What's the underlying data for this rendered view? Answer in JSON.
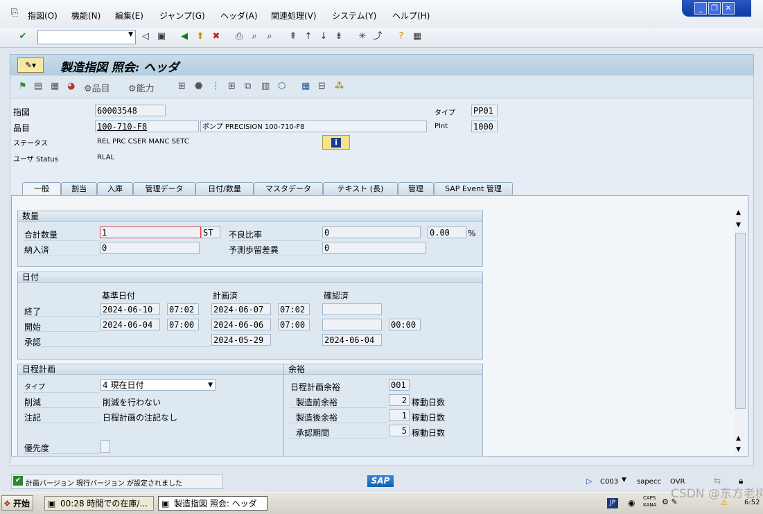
{
  "menu": [
    "指図(O)",
    "機能(N)",
    "編集(E)",
    "ジャンプ(G)",
    "ヘッダ(A)",
    "関連処理(V)",
    "システム(Y)",
    "ヘルプ(H)"
  ],
  "window_controls": {
    "minimize": "_",
    "restore": "❐",
    "close": "✕"
  },
  "title": "製造指図 照会: ヘッダ",
  "app_toolbar": {
    "components": "品目",
    "capacity": "能力"
  },
  "header": {
    "order_label": "指図",
    "order_value": "60003548",
    "material_label": "品目",
    "material_value": "100-710-F8",
    "material_desc": "ポンプ PRECISION 100-710-F8",
    "status_label": "ステータス",
    "status_value": "REL  PRC  CSER MANC SETC",
    "user_status_label": "ユーザ Status",
    "user_status_value": "RLAL",
    "type_label": "タイプ",
    "type_value": "PP01",
    "plant_label": "Plnt",
    "plant_value": "1000",
    "info_icon": "i"
  },
  "tabs": [
    "一般",
    "割当",
    "入庫",
    "管理データ",
    "日付/数量",
    "マスタデータ",
    "テキスト (長)",
    "管理",
    "SAP Event 管理"
  ],
  "quantity": {
    "title": "数量",
    "total_label": "合計数量",
    "total_value": "1",
    "unit": "ST",
    "scrap_label": "不良比率",
    "scrap_value": "0",
    "scrap_pct": "0.00",
    "pct_sign": "%",
    "delivered_label": "納入済",
    "delivered_value": "0",
    "expected_label": "予測歩留差異",
    "expected_value": "0"
  },
  "dates": {
    "title": "日付",
    "col_basic": "基準日付",
    "col_scheduled": "計画済",
    "col_confirmed": "確認済",
    "finish_label": "終了",
    "finish_basic_date": "2024-06-10",
    "finish_basic_time": "07:02",
    "finish_sched_date": "2024-06-07",
    "finish_sched_time": "07:02",
    "start_label": "開始",
    "start_basic_date": "2024-06-04",
    "start_basic_time": "07:00",
    "start_sched_date": "2024-06-06",
    "start_sched_time": "07:00",
    "start_conf_time": "00:00",
    "release_label": "承認",
    "release_sched_date": "2024-05-29",
    "release_conf_date": "2024-06-04"
  },
  "scheduling": {
    "title": "日程計画",
    "type_label": "タイプ",
    "type_value": "4 現在日付",
    "reduction_label": "削減",
    "reduction_value": "削減を行わない",
    "note_label": "注記",
    "note_value": "日程計画の注記なし",
    "priority_label": "優先度"
  },
  "float": {
    "title": "余裕",
    "sm_label": "日程計画余裕",
    "sm_value": "001",
    "before_label": "製造前余裕",
    "before_value": "2",
    "before_unit": "稼動日数",
    "after_label": "製造後余裕",
    "after_value": "1",
    "after_unit": "稼動日数",
    "release_label": "承認期間",
    "release_value": "5",
    "release_unit": "稼動日数"
  },
  "statusbar": {
    "message": "計画バージョン 現行バージョン が設定されました",
    "sap_logo": "SAP",
    "client": "C003",
    "server": "sapecc",
    "mode": "OVR"
  },
  "taskbar": {
    "start": "开始",
    "task1": "00:28 時間での在庫/...",
    "task2": "製造指図 照会: ヘッダ",
    "lang": "JP",
    "caps": "CAPS",
    "kana": "KANA",
    "watermark": "CSDN @东方老树根",
    "time": "6:52"
  }
}
